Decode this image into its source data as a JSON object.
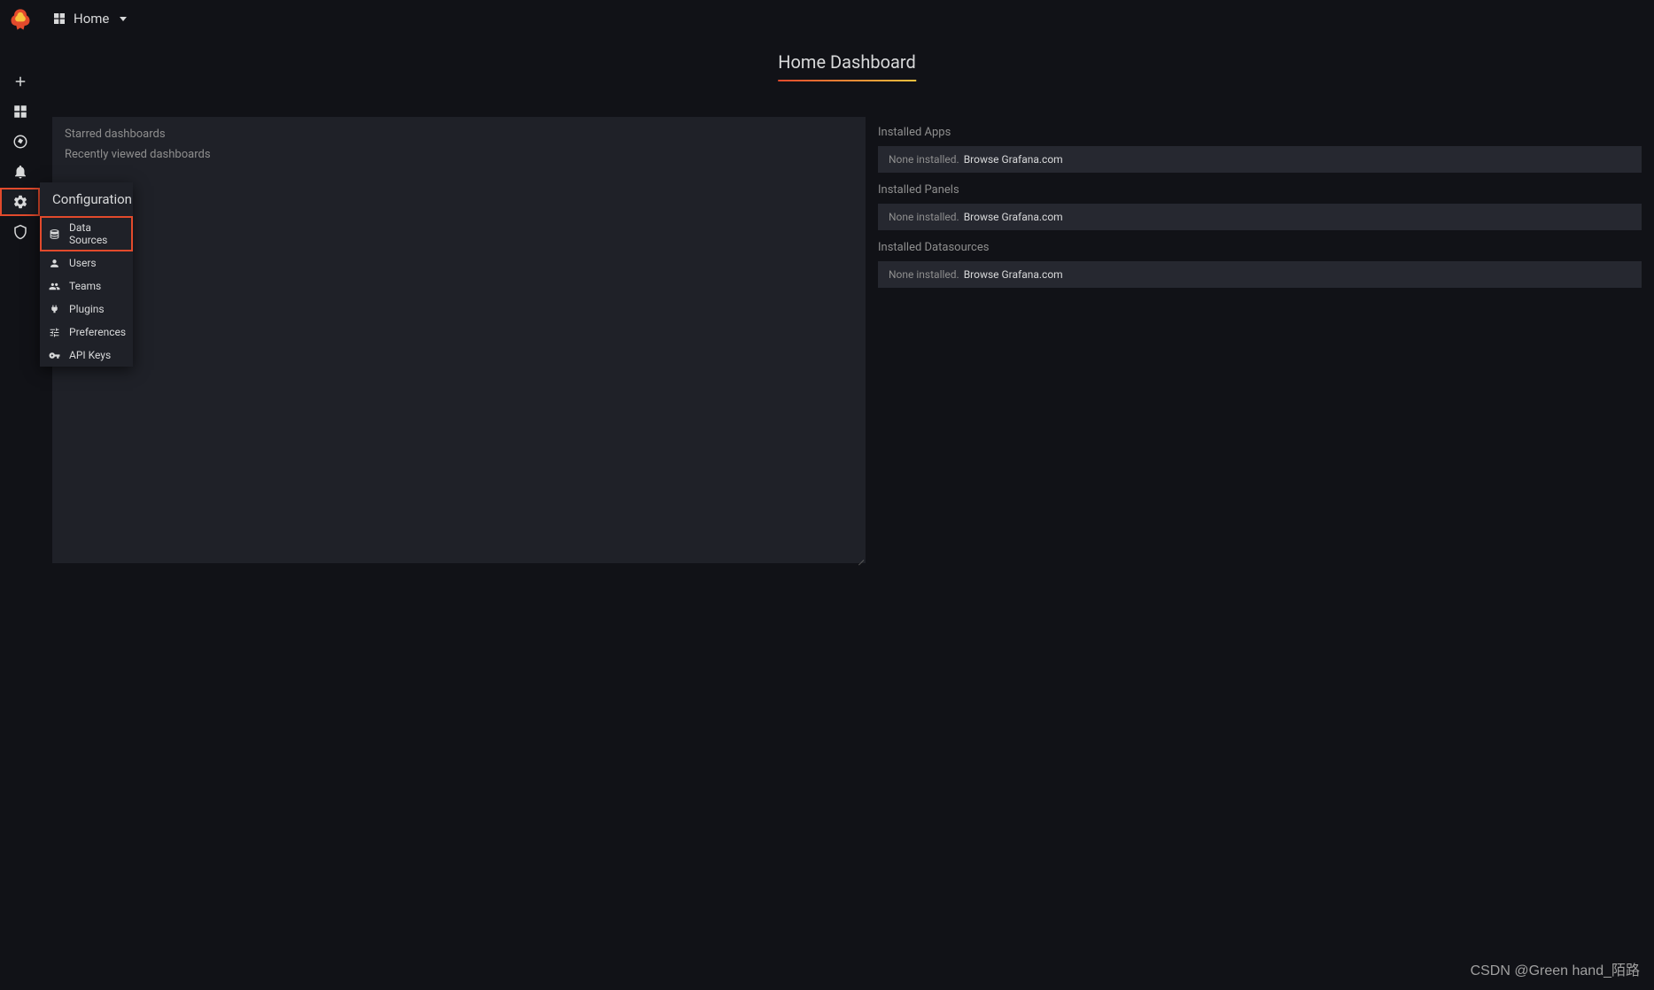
{
  "breadcrumb": {
    "label": "Home"
  },
  "page": {
    "title": "Home Dashboard"
  },
  "left_panel": {
    "starred": "Starred dashboards",
    "recent": "Recently viewed dashboards"
  },
  "right_panel": {
    "sections": [
      {
        "title": "Installed Apps",
        "none_text": "None installed.",
        "link_text": "Browse Grafana.com"
      },
      {
        "title": "Installed Panels",
        "none_text": "None installed.",
        "link_text": "Browse Grafana.com"
      },
      {
        "title": "Installed Datasources",
        "none_text": "None installed.",
        "link_text": "Browse Grafana.com"
      }
    ]
  },
  "flyout": {
    "header": "Configuration",
    "items": [
      {
        "label": "Data Sources",
        "icon": "database"
      },
      {
        "label": "Users",
        "icon": "user"
      },
      {
        "label": "Teams",
        "icon": "users"
      },
      {
        "label": "Plugins",
        "icon": "plug"
      },
      {
        "label": "Preferences",
        "icon": "sliders"
      },
      {
        "label": "API Keys",
        "icon": "key"
      }
    ]
  },
  "watermark": "CSDN @Green hand_陌路"
}
